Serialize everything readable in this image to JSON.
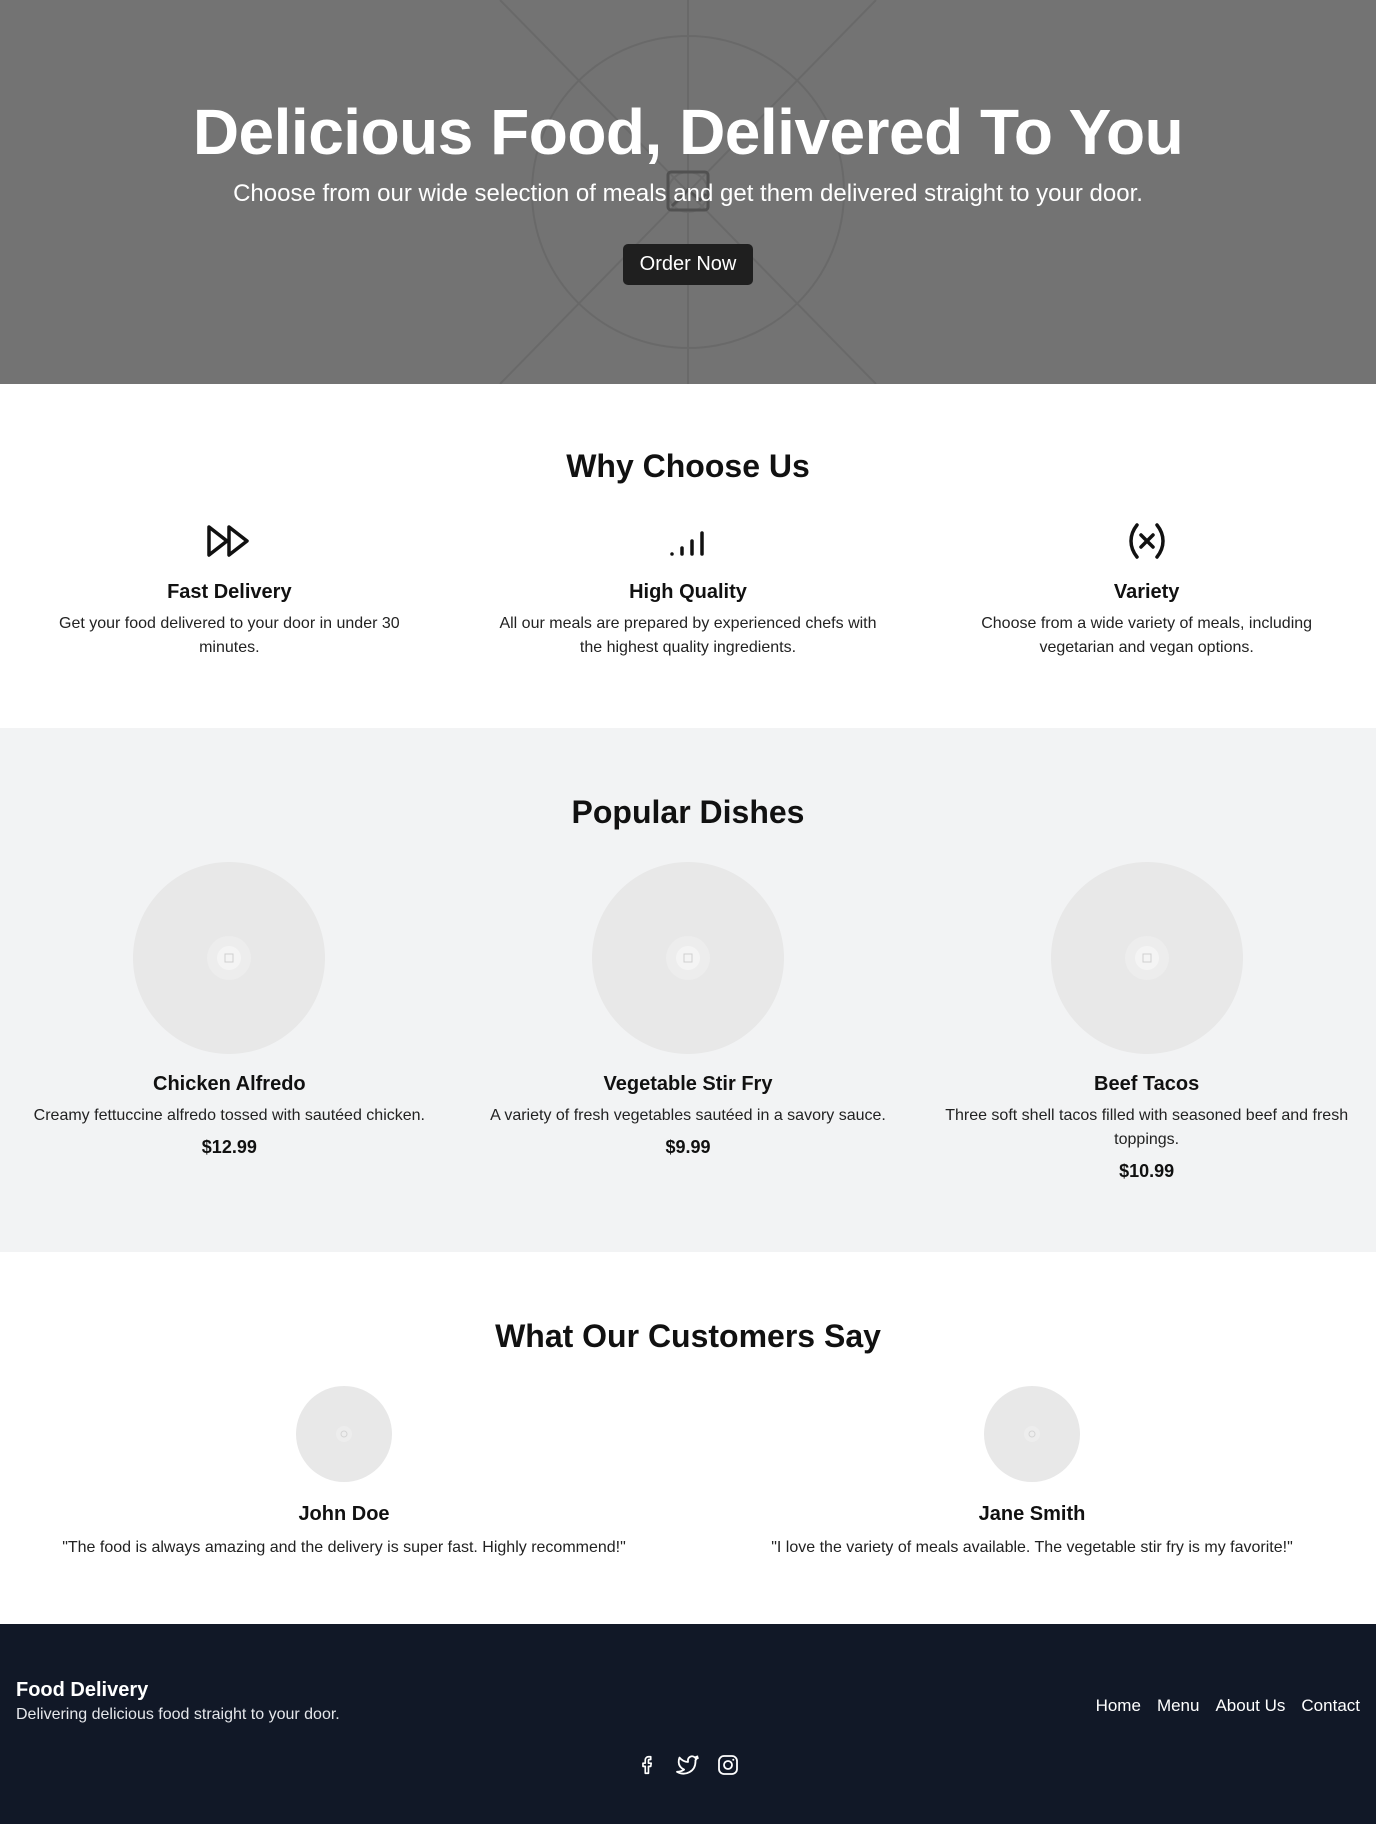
{
  "hero": {
    "title": "Delicious Food, Delivered To You",
    "subtitle": "Choose from our wide selection of meals and get them delivered straight to your door.",
    "cta_label": "Order Now"
  },
  "features": {
    "title": "Why Choose Us",
    "items": [
      {
        "icon": "fast-forward-icon",
        "title": "Fast Delivery",
        "text": "Get your food delivered to your door in under 30 minutes."
      },
      {
        "icon": "signal-bars-icon",
        "title": "High Quality",
        "text": "All our meals are prepared by experienced chefs with the highest quality ingredients."
      },
      {
        "icon": "variable-icon",
        "title": "Variety",
        "text": "Choose from a wide variety of meals, including vegetarian and vegan options."
      }
    ]
  },
  "dishes": {
    "title": "Popular Dishes",
    "items": [
      {
        "name": "Chicken Alfredo",
        "description": "Creamy fettuccine alfredo tossed with sautéed chicken.",
        "price": "$12.99"
      },
      {
        "name": "Vegetable Stir Fry",
        "description": "A variety of fresh vegetables sautéed in a savory sauce.",
        "price": "$9.99"
      },
      {
        "name": "Beef Tacos",
        "description": "Three soft shell tacos filled with seasoned beef and fresh toppings.",
        "price": "$10.99"
      }
    ]
  },
  "testimonials": {
    "title": "What Our Customers Say",
    "items": [
      {
        "name": "John Doe",
        "quote": "\"The food is always amazing and the delivery is super fast. Highly recommend!\""
      },
      {
        "name": "Jane Smith",
        "quote": "\"I love the variety of meals available. The vegetable stir fry is my favorite!\""
      }
    ]
  },
  "footer": {
    "brand": "Food Delivery",
    "tagline": "Delivering delicious food straight to your door.",
    "nav": [
      "Home",
      "Menu",
      "About Us",
      "Contact"
    ],
    "socials": [
      "facebook-icon",
      "twitter-icon",
      "instagram-icon"
    ]
  },
  "colors": {
    "hero_bg": "#737373",
    "button_bg": "#1f1f1f",
    "dishes_bg": "#f2f3f4",
    "footer_bg": "#111827",
    "placeholder": "#e8e8e8"
  }
}
